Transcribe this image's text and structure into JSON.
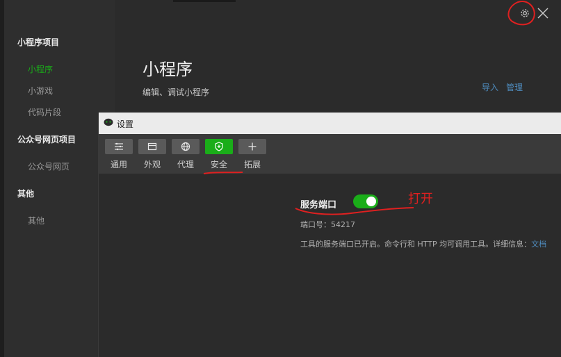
{
  "sidebar": {
    "sections": [
      {
        "title": "小程序项目",
        "items": [
          "小程序",
          "小游戏",
          "代码片段"
        ]
      },
      {
        "title": "公众号网页项目",
        "items": [
          "公众号网页"
        ]
      },
      {
        "title": "其他",
        "items": [
          "其他"
        ]
      }
    ],
    "active_item": "小程序"
  },
  "main": {
    "title": "小程序",
    "subtitle": "编辑、调试小程序",
    "links": [
      "导入",
      "管理"
    ]
  },
  "window_controls": {
    "icons": [
      "gear-icon",
      "close-icon"
    ]
  },
  "dialog": {
    "title": "设置",
    "tabs": [
      {
        "label": "通用",
        "icon": "list-icon"
      },
      {
        "label": "外观",
        "icon": "window-icon"
      },
      {
        "label": "代理",
        "icon": "globe-icon"
      },
      {
        "label": "安全",
        "icon": "shield-icon"
      },
      {
        "label": "拓展",
        "icon": "plus-icon"
      }
    ],
    "active_tab": "安全",
    "security": {
      "service_port_label": "服务端口",
      "service_port_enabled": true,
      "port_text": "端口号：54217",
      "info_text": "工具的服务端口已开启。命令行和 HTTP 均可调用工具。详细信息：",
      "info_link": "文档"
    }
  },
  "annotation": {
    "text": "打开",
    "color": "#e02020"
  },
  "colors": {
    "accent": "#1aad19",
    "link": "#4e8bbd",
    "annotation": "#e02020"
  }
}
